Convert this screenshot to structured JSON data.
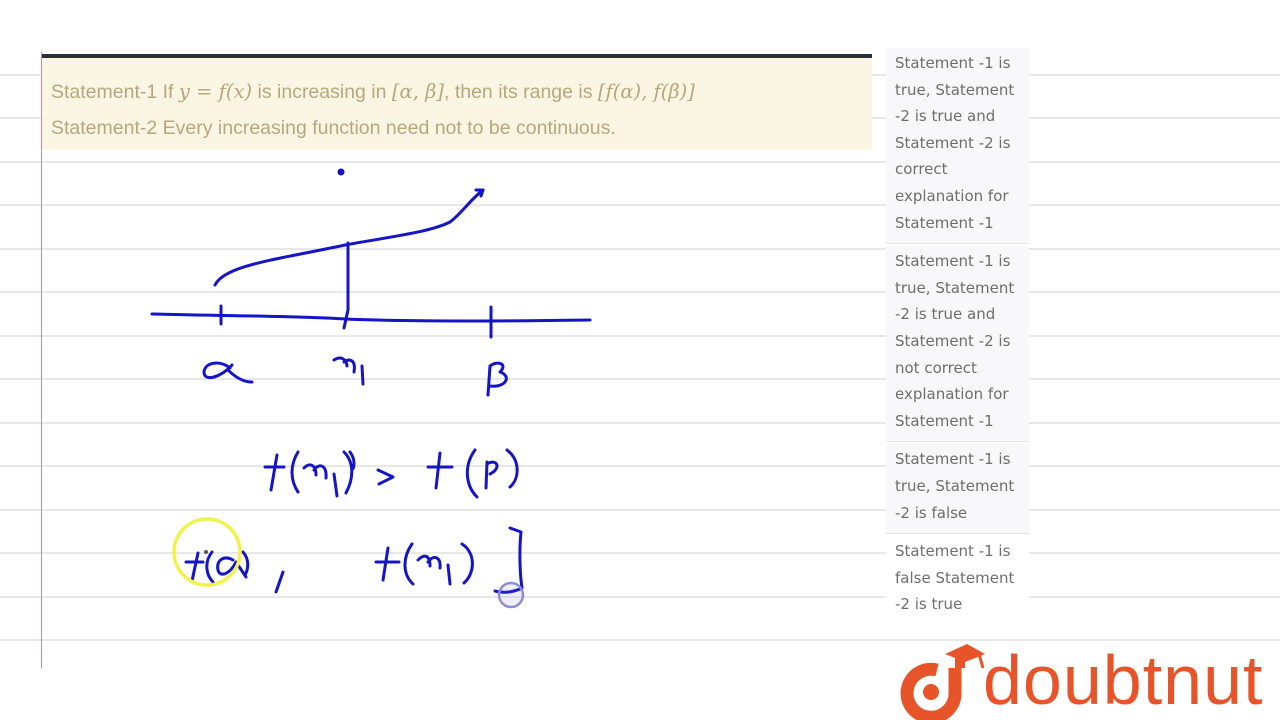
{
  "question": {
    "statement1_prefix": "Statement-1 If ",
    "statement1_math1": "y = f(x)",
    "statement1_mid": " is increasing in ",
    "statement1_math2": "[α, β]",
    "statement1_mid2": ", then its range is ",
    "statement1_math3": "[f(α), f(β)]",
    "statement2": "Statement-2 Every increasing function need not to be continuous."
  },
  "options": [
    {
      "label": "Statement -1 is true, Statement -2 is true and Statement -2 is correct explanation for Statement -1"
    },
    {
      "label": "Statement -1 is true, Statement -2 is true and Statement -2 is not correct explanation for Statement -1"
    },
    {
      "label": "Statement -1 is true, Statement -2 is false"
    },
    {
      "label": "Statement -1 is false Statement -2 is true"
    }
  ],
  "handwriting": {
    "axis_labels": [
      "α",
      "x₁",
      "β"
    ],
    "line1": "f(x₁) > f(β)",
    "line2": "f(α) , f(x₁) ]"
  },
  "brand": {
    "name": "doubtnut",
    "color": "#e8542a"
  },
  "colors": {
    "ink": "#1414c8",
    "highlight": "#f2f24a",
    "question_bg": "#fbf6e4",
    "question_text": "#b7a77c"
  }
}
